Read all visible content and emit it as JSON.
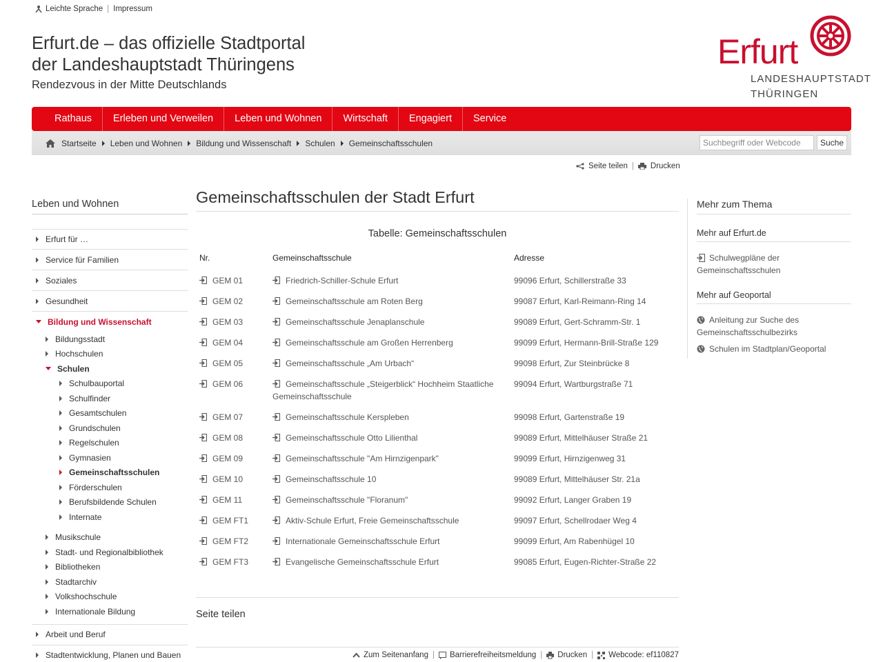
{
  "util": {
    "easy_language": "Leichte Sprache",
    "imprint": "Impressum"
  },
  "site": {
    "title_line1": "Erfurt.de – das offizielle Stadtportal",
    "title_line2": "der Landeshauptstadt Thüringens",
    "tagline": "Rendezvous in der Mitte Deutschlands",
    "logo_word": "Erfurt",
    "logo_line1": "LANDESHAUPTSTADT",
    "logo_line2": "THÜRINGEN",
    "brand_color": "#e30613"
  },
  "nav": [
    "Rathaus",
    "Erleben und Verweilen",
    "Leben und Wohnen",
    "Wirtschaft",
    "Engagiert",
    "Service"
  ],
  "breadcrumb": [
    "Startseite",
    "Leben und Wohnen",
    "Bildung und Wissenschaft",
    "Schulen",
    "Gemeinschaftsschulen"
  ],
  "search": {
    "placeholder": "Suchbegriff oder Webcode",
    "button": "Suche"
  },
  "tools": {
    "share": "Seite teilen",
    "print": "Drucken"
  },
  "left": {
    "heading": "Leben und Wohnen",
    "top1": [
      "Erfurt für …",
      "Service für Familien",
      "Soziales",
      "Gesundheit"
    ],
    "active": "Bildung und Wissenschaft",
    "sub_a": [
      "Bildungsstadt",
      "Hochschulen"
    ],
    "schools": "Schulen",
    "sub_schools": [
      "Schulbauportal",
      "Schulfinder",
      "Gesamtschulen",
      "Grundschulen",
      "Regelschulen",
      "Gymnasien",
      "Gemeinschaftsschulen",
      "Förderschulen",
      "Berufsbildende Schulen",
      "Internate"
    ],
    "sub_b": [
      "Musikschule",
      "Stadt- und Regionalbibliothek",
      "Bibliotheken",
      "Stadtarchiv",
      "Volkshochschule",
      "Internationale Bildung"
    ],
    "top2": [
      "Arbeit und Beruf",
      "Stadtentwicklung, Planen und Bauen"
    ]
  },
  "main": {
    "title": "Gemeinschaftsschulen der Stadt Erfurt",
    "caption": "Tabelle: Gemeinschaftsschulen",
    "headers": [
      "Nr.",
      "Gemeinschaftsschule",
      "Adresse"
    ],
    "rows": [
      [
        "GEM 01",
        "Friedrich-Schiller-Schule Erfurt",
        "99096 Erfurt, Schillerstraße 33"
      ],
      [
        "GEM 02",
        "Gemeinschaftsschule am Roten Berg",
        "99087 Erfurt, Karl-Reimann-Ring 14"
      ],
      [
        "GEM 03",
        "Gemeinschaftsschule Jenaplanschule",
        "99089 Erfurt, Gert-Schramm-Str. 1"
      ],
      [
        "GEM 04",
        "Gemeinschaftsschule am Großen Herrenberg",
        "99099 Erfurt, Hermann-Brill-Straße 129"
      ],
      [
        "GEM 05",
        "Gemeinschaftsschule „Am Urbach“",
        "99098 Erfurt, Zur Steinbrücke 8"
      ],
      [
        "GEM 06",
        "Gemeinschaftsschule „Steigerblick“ Hochheim Staatliche Gemeinschaftsschule",
        "99094 Erfurt, Wartburgstraße 71"
      ],
      [
        "GEM 07",
        "Gemeinschaftsschule Kerspleben",
        "99098 Erfurt, Gartenstraße 19"
      ],
      [
        "GEM 08",
        "Gemeinschaftsschule Otto Lilienthal",
        "99089 Erfurt, Mittelhäuser Straße 21"
      ],
      [
        "GEM 09",
        "Gemeinschaftsschule \"Am Hirnzigenpark\"",
        "99099 Erfurt, Hirnzigenweg 31"
      ],
      [
        "GEM 10",
        "Gemeinschaftsschule 10",
        "99089 Erfurt, Mittelhäuser Str. 21a"
      ],
      [
        "GEM 11",
        "Gemeinschaftsschule \"Floranum\"",
        "99092 Erfurt, Langer Graben 19"
      ],
      [
        "GEM FT1",
        "Aktiv-Schule Erfurt, Freie Gemeinschaftsschule",
        "99097 Erfurt, Schellrodaer Weg 4"
      ],
      [
        "GEM FT2",
        "Internationale Gemeinschaftsschule Erfurt",
        "99099 Erfurt, Am Rabenhügel 10"
      ],
      [
        "GEM FT3",
        "Evangelische Gemeinschaftsschule Erfurt",
        "99085 Erfurt, Eugen-Richter-Straße 22"
      ]
    ],
    "share_heading": "Seite teilen"
  },
  "right": {
    "heading": "Mehr zum Thema",
    "section1": "Mehr auf Erfurt.de",
    "link1": "Schulwegpläne der Gemeinschaftsschulen",
    "section2": "Mehr auf Geoportal",
    "link2": "Anleitung zur Suche des Gemeinschaftsschulbezirks",
    "link3": "Schulen im Stadtplan/Geoportal"
  },
  "footer": {
    "top": "Zum Seitenanfang",
    "accessibility": "Barrierefreiheitsmeldung",
    "print": "Drucken",
    "webcode": "Webcode: ef110827"
  }
}
